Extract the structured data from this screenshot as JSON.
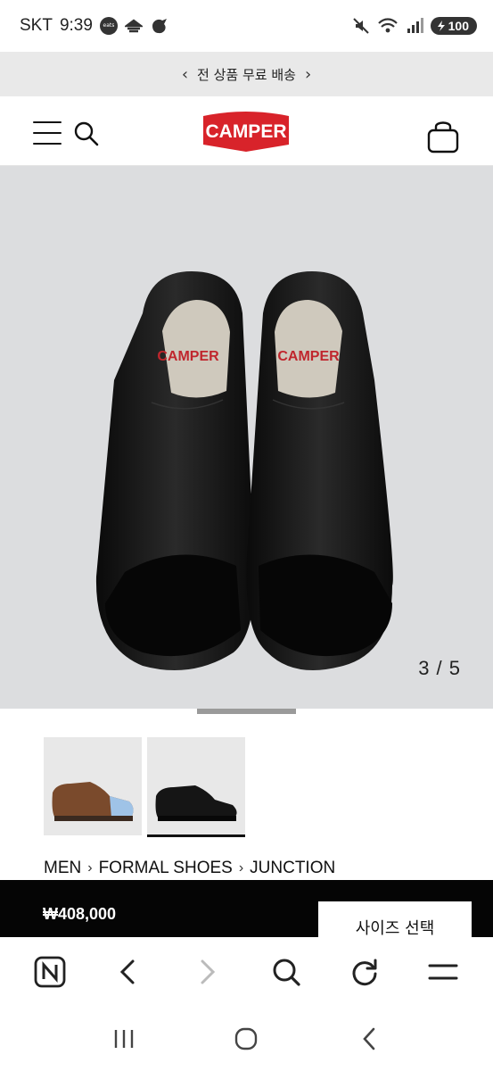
{
  "status": {
    "carrier": "SKT",
    "time": "9:39",
    "notif_icon_text": "eats",
    "battery": "100"
  },
  "promo": {
    "text": "전 상품 무료 배송"
  },
  "header": {
    "logo_text": "CAMPER"
  },
  "gallery": {
    "counter": "3 / 5",
    "insole_brand": "CAMPER"
  },
  "breadcrumb": [
    "MEN",
    "FORMAL SHOES",
    "JUNCTION"
  ],
  "purchase": {
    "price": "₩408,000",
    "size_button": "사이즈 선택"
  },
  "icons": {
    "menu": "hamburger-icon",
    "search": "search-icon",
    "bag": "shopping-bag-icon",
    "browser_home": "naver-n-icon",
    "back": "back-arrow-icon",
    "forward": "forward-arrow-icon",
    "browser_search": "search-icon",
    "reload": "reload-icon",
    "browser_menu": "menu-icon"
  },
  "colors": {
    "brand": "#d8232a",
    "price_bar": "#050505",
    "promo_bg": "#e9e9e9"
  }
}
